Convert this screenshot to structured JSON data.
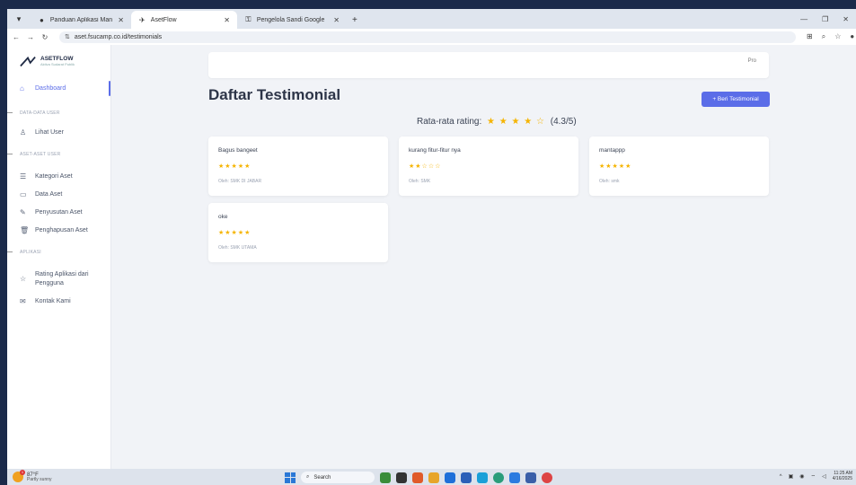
{
  "browser": {
    "tabs": [
      {
        "title": "Panduan Aplikasi Manajemen A",
        "active": false
      },
      {
        "title": "AsetFlow",
        "active": true
      },
      {
        "title": "Pengelola Sandi Google",
        "active": false
      }
    ],
    "new_tab": "+",
    "url": "aset.fsucamp.co.id/testimonials"
  },
  "sidebar": {
    "brand_name": "ASETFLOW",
    "brand_sub": "Aktiva Sudarat Publik",
    "items": [
      {
        "label": "Dashboard",
        "icon": "home-icon"
      },
      {
        "label": "Lihat User",
        "icon": "user-icon"
      },
      {
        "label": "Kategori Aset",
        "icon": "list-icon"
      },
      {
        "label": "Data Aset",
        "icon": "calendar-icon"
      },
      {
        "label": "Penyusutan Aset",
        "icon": "wrench-icon"
      },
      {
        "label": "Penghapusan Aset",
        "icon": "trash-icon"
      },
      {
        "label": "Rating Aplikasi dari Pengguna",
        "icon": "star-icon"
      },
      {
        "label": "Kontak Kami",
        "icon": "mail-icon"
      }
    ],
    "headings": [
      "DATA-DATA USER",
      "ASET-ASET USER",
      "APLIKASI"
    ]
  },
  "header": {
    "profile_alt": "Pro"
  },
  "main": {
    "title": "Daftar Testimonial",
    "add_button": "+ Beri Testimonial",
    "avg_label": "Rata-rata rating:",
    "avg_stars": "★ ★ ★ ★ ☆",
    "avg_value": "(4.3/5)",
    "cards": [
      {
        "title": "Bagus bangeet",
        "stars": "★★★★★",
        "by": "Oleh: SMK DI JABAR"
      },
      {
        "title": "kurang fitur-fitur nya",
        "stars": "★★☆☆☆",
        "by": "Oleh: SMK"
      },
      {
        "title": "mantappp",
        "stars": "★★★★★",
        "by": "Oleh: smk"
      },
      {
        "title": "oke",
        "stars": "★★★★★",
        "by": "Oleh: SMK UTAMA"
      }
    ]
  },
  "taskbar": {
    "temp": "87°F",
    "weather": "Partly sunny",
    "search": "Search",
    "time": "11:25 AM",
    "date": "4/16/2025"
  },
  "colors": {
    "accent": "#5b6de8",
    "star": "#f5b400"
  }
}
